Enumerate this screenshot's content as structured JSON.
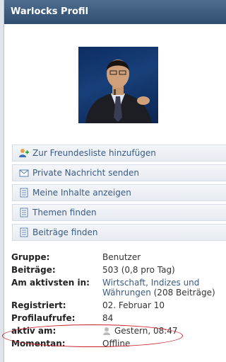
{
  "header": {
    "title": "Warlocks Profil"
  },
  "actions": [
    {
      "label": "Zur Freundesliste hinzufügen",
      "icon": "add-friend-icon"
    },
    {
      "label": "Private Nachricht senden",
      "icon": "envelope-icon"
    },
    {
      "label": "Meine Inhalte anzeigen",
      "icon": "document-icon"
    },
    {
      "label": "Themen finden",
      "icon": "document-icon"
    },
    {
      "label": "Beiträge finden",
      "icon": "document-icon"
    }
  ],
  "info": {
    "group_label": "Gruppe:",
    "group_value": "Benutzer",
    "posts_label": "Beiträge:",
    "posts_value": "503 (0,8 pro Tag)",
    "most_active_label": "Am aktivsten in:",
    "most_active_link_line1": "Wirtschaft, Indizes und",
    "most_active_link_line2": "Währungen",
    "most_active_suffix": " (208 Beiträge)",
    "registered_label": "Registriert:",
    "registered_value": "02. Februar 10",
    "views_label": "Profilaufrufe:",
    "views_value": "84",
    "active_label": "aktiv am:",
    "active_value": "Gestern, 08:47",
    "current_label": "Momentan:",
    "current_value": "Offline"
  },
  "highlight_color": "#c8202a"
}
